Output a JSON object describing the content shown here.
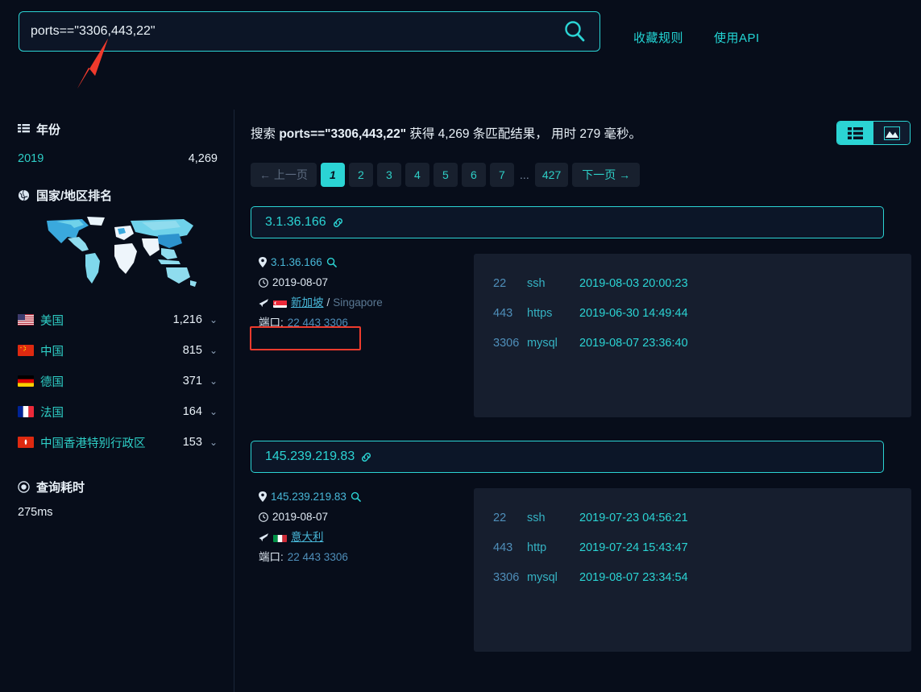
{
  "search": {
    "query": "ports==\"3306,443,22\"",
    "placeholder": "ports==\"3306,443,22\"",
    "search_icon": "search-icon"
  },
  "topnav": {
    "items": [
      {
        "label": "收藏规则"
      },
      {
        "label": "使用API"
      }
    ]
  },
  "sidebar": {
    "year_section": {
      "title": "年份",
      "icon": "list-icon",
      "rows": [
        {
          "label": "2019",
          "value": "4,269"
        }
      ]
    },
    "country_section": {
      "title": "国家/地区排名",
      "icon": "globe-icon",
      "rows": [
        {
          "label": "美国",
          "value": "1,216",
          "flag": "us"
        },
        {
          "label": "中国",
          "value": "815",
          "flag": "cn"
        },
        {
          "label": "德国",
          "value": "371",
          "flag": "de"
        },
        {
          "label": "法国",
          "value": "164",
          "flag": "fr"
        },
        {
          "label": "中国香港特别行政区",
          "value": "153",
          "flag": "hk"
        }
      ]
    },
    "query_time": {
      "title": "查询耗时",
      "icon": "target-icon",
      "value": "275ms"
    }
  },
  "main": {
    "summary": {
      "prefix": "搜索 ",
      "query": "ports==\"3306,443,22\"",
      "middle": " 获得 4,269 条匹配结果， 用时 279 毫秒。",
      "total_results": "4,269",
      "elapsed_ms": "279"
    },
    "view_toggle": {
      "list_icon": "list-view-icon",
      "chart_icon": "chart-view-icon",
      "active": "list"
    },
    "pagination": {
      "prev_label": "← 上一页",
      "next_label": "下一页 →",
      "pages": [
        "1",
        "2",
        "3",
        "4",
        "5",
        "6",
        "7"
      ],
      "ellipsis": "...",
      "last_page": "427",
      "current": "1"
    },
    "results": [
      {
        "ip": "3.1.36.166",
        "link_icon": "link-icon",
        "location_icon": "pin-icon",
        "magnifier_icon": "search-icon",
        "clock_icon": "clock-icon",
        "date": "2019-08-07",
        "plane_icon": "plane-icon",
        "flag": "sg",
        "country_cn": "新加坡",
        "separator": "/",
        "country_en": "Singapore",
        "ports_label": "端口:",
        "ports_value": "22 443 3306",
        "services": [
          {
            "port": "22",
            "name": "ssh",
            "date": "2019-08-03 20:00:23"
          },
          {
            "port": "443",
            "name": "https",
            "date": "2019-06-30 14:49:44"
          },
          {
            "port": "3306",
            "name": "mysql",
            "date": "2019-08-07 23:36:40"
          }
        ]
      },
      {
        "ip": "145.239.219.83",
        "link_icon": "link-icon",
        "location_icon": "pin-icon",
        "magnifier_icon": "search-icon",
        "clock_icon": "clock-icon",
        "date": "2019-08-07",
        "plane_icon": "plane-icon",
        "flag": "it",
        "country_cn": "意大利",
        "separator": "",
        "country_en": "",
        "ports_label": "端口:",
        "ports_value": "22 443 3306",
        "services": [
          {
            "port": "22",
            "name": "ssh",
            "date": "2019-07-23 04:56:21"
          },
          {
            "port": "443",
            "name": "http",
            "date": "2019-07-24 15:43:47"
          },
          {
            "port": "3306",
            "name": "mysql",
            "date": "2019-08-07 23:34:54"
          }
        ]
      }
    ]
  },
  "annotations": {
    "arrow": "red-arrow-pointing-to-search-query",
    "highlight_box": "red-box-around-ports-line"
  },
  "colors": {
    "accent": "#2bd4d4",
    "background": "#070d1a",
    "panel": "#161e2e",
    "annotation_red": "#ee3b2d",
    "link_blue": "#48b7d8"
  }
}
